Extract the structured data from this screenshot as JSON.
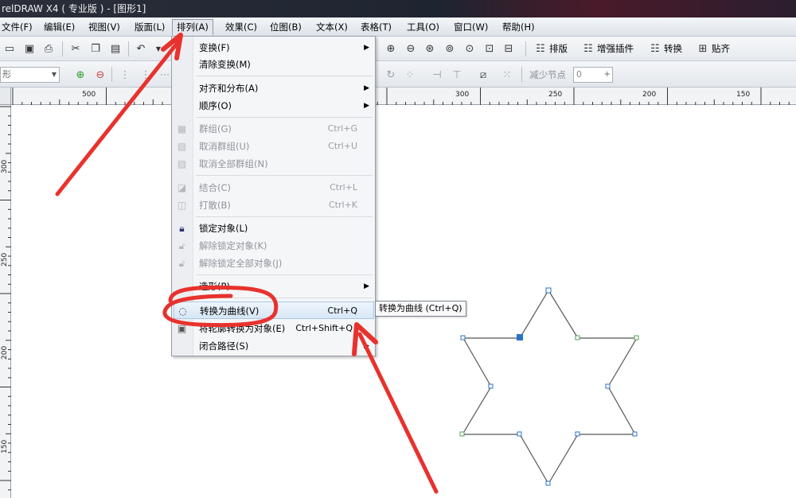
{
  "window": {
    "title": "relDRAW X4 ( 专业版 ) - [图形1]"
  },
  "menubar": {
    "items": [
      {
        "label": "文件(F)"
      },
      {
        "label": "编辑(E)"
      },
      {
        "label": "视图(V)"
      },
      {
        "label": "版面(L)"
      },
      {
        "label": "排列(A)"
      },
      {
        "label": "效果(C)"
      },
      {
        "label": "位图(B)"
      },
      {
        "label": "文本(X)"
      },
      {
        "label": "表格(T)"
      },
      {
        "label": "工具(O)"
      },
      {
        "label": "窗口(W)"
      },
      {
        "label": "帮助(H)"
      }
    ]
  },
  "toolbar": {
    "plugins": [
      {
        "label": "排版"
      },
      {
        "label": "增强插件"
      },
      {
        "label": "转换"
      },
      {
        "label": "贴齐"
      }
    ]
  },
  "property_bar": {
    "shape_combo": "形",
    "reduce_nodes_label": "减少节点",
    "reduce_nodes_value": "0"
  },
  "ruler": {
    "top": [
      "500",
      "300",
      "250",
      "200",
      "150"
    ],
    "left": [
      "300",
      "250",
      "200",
      "150"
    ]
  },
  "arrange_menu": {
    "items": [
      {
        "label": "变换(F)",
        "shortcut": ""
      },
      {
        "label": "清除变换(M)",
        "shortcut": ""
      },
      {
        "label": "对齐和分布(A)",
        "shortcut": ""
      },
      {
        "label": "顺序(O)",
        "shortcut": ""
      },
      {
        "label": "群组(G)",
        "shortcut": "Ctrl+G"
      },
      {
        "label": "取消群组(U)",
        "shortcut": "Ctrl+U"
      },
      {
        "label": "取消全部群组(N)",
        "shortcut": ""
      },
      {
        "label": "结合(C)",
        "shortcut": "Ctrl+L"
      },
      {
        "label": "打散(B)",
        "shortcut": "Ctrl+K"
      },
      {
        "label": "锁定对象(L)",
        "shortcut": ""
      },
      {
        "label": "解除锁定对象(K)",
        "shortcut": ""
      },
      {
        "label": "解除锁定全部对象(J)",
        "shortcut": ""
      },
      {
        "label": "造形(P)",
        "shortcut": ""
      },
      {
        "label": "转换为曲线(V)",
        "shortcut": "Ctrl+Q"
      },
      {
        "label": "将轮廓转换为对象(E)",
        "shortcut": "Ctrl+Shift+Q"
      },
      {
        "label": "闭合路径(S)",
        "shortcut": ""
      }
    ]
  },
  "tooltip": {
    "text": "转换为曲线 (Ctrl+Q)"
  },
  "annotation_color": "#e8322d"
}
